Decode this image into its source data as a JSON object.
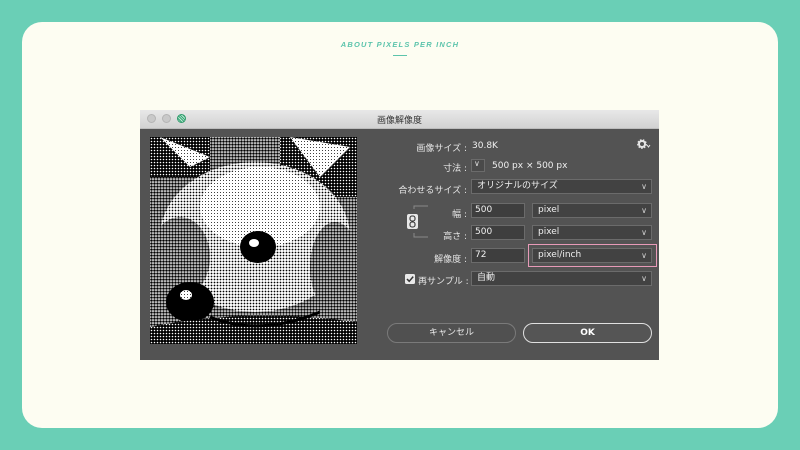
{
  "page": {
    "heading": "ABOUT PIXELS PER INCH"
  },
  "dialog": {
    "title": "画像解像度",
    "image_size_label": "画像サイズ :",
    "image_size_value": "30.8K",
    "dimensions_label": "寸法 :",
    "dimensions_value": "500 px × 500 px",
    "fit_label": "合わせるサイズ :",
    "fit_value": "オリジナルのサイズ",
    "width_label": "幅 :",
    "width_value": "500",
    "width_unit": "pixel",
    "height_label": "高さ :",
    "height_value": "500",
    "height_unit": "pixel",
    "resolution_label": "解像度 :",
    "resolution_value": "72",
    "resolution_unit": "pixel/inch",
    "resample_label": "再サンプル :",
    "resample_value": "自動",
    "resample_checked": true,
    "cancel_label": "キャンセル",
    "ok_label": "OK"
  },
  "icons": {
    "gear": "gear-icon",
    "link": "link-icon",
    "chevron": "chevron-down-icon",
    "checkbox": "checkbox-checked-icon"
  },
  "colors": {
    "frame": "#6acfb6",
    "card": "#fdfdf2",
    "accent": "#5cc4ac",
    "dialog_bg": "#535353",
    "highlight": "#e79ab8"
  }
}
